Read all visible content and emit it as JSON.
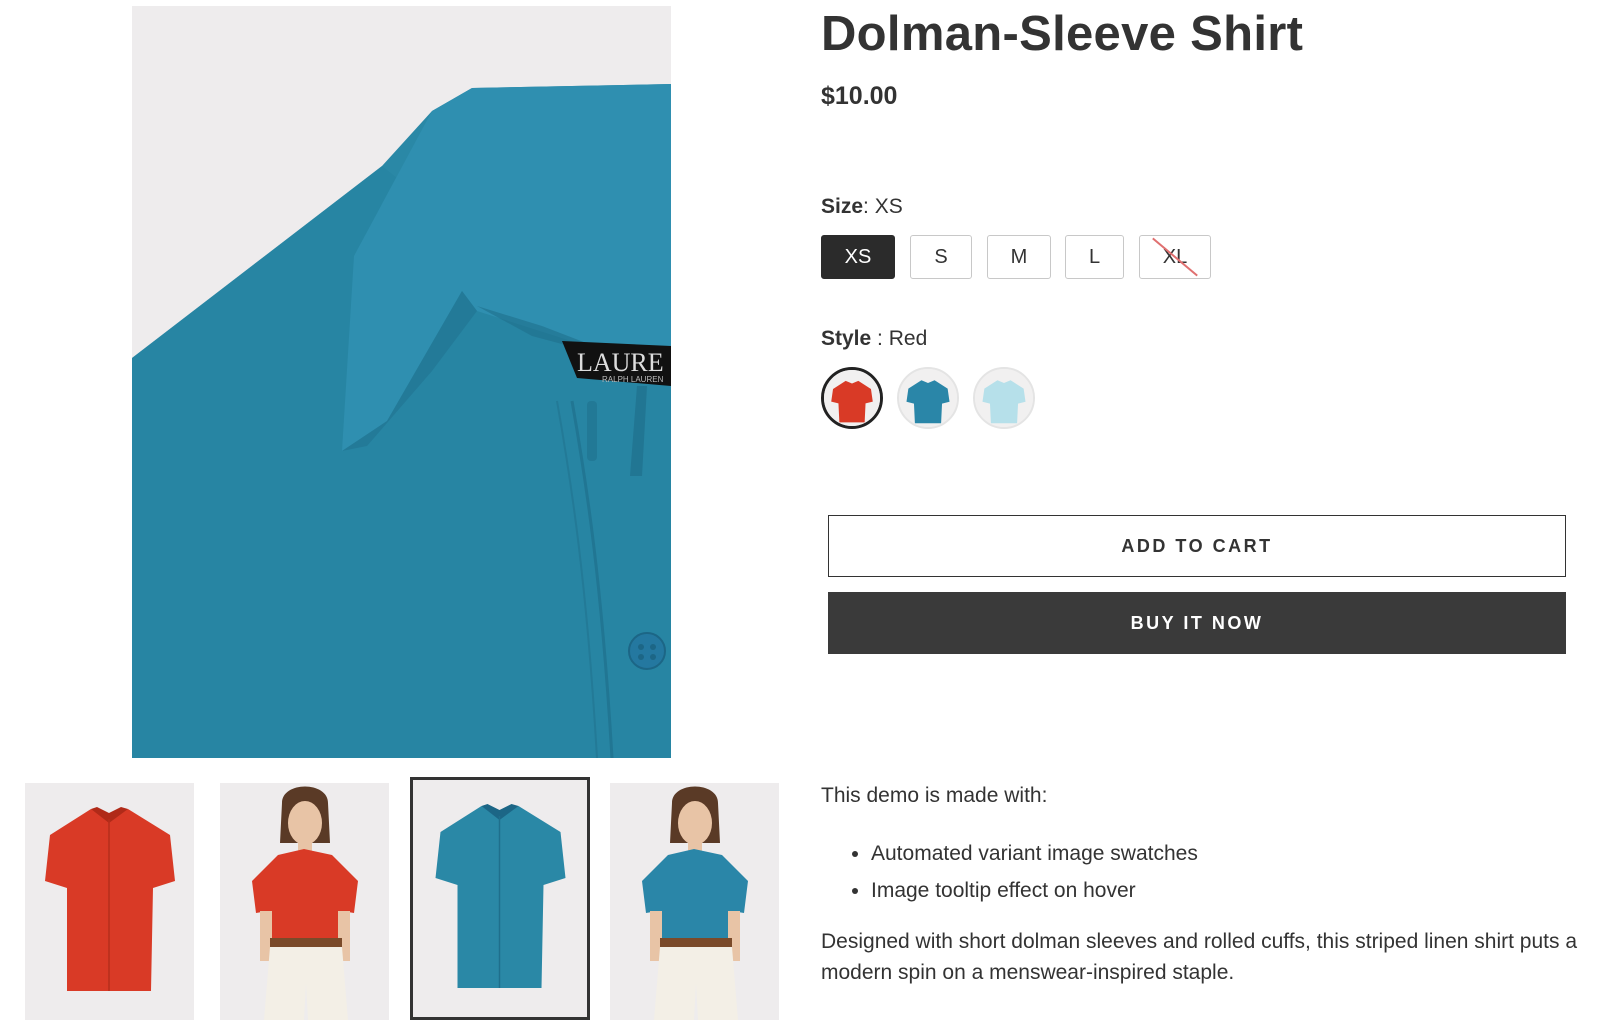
{
  "product": {
    "title": "Dolman-Sleeve Shirt",
    "price": "$10.00"
  },
  "size": {
    "label": "Size",
    "selected": "XS",
    "options": [
      {
        "value": "XS",
        "selected": true,
        "available": true
      },
      {
        "value": "S",
        "selected": false,
        "available": true
      },
      {
        "value": "M",
        "selected": false,
        "available": true
      },
      {
        "value": "L",
        "selected": false,
        "available": true
      },
      {
        "value": "XL",
        "selected": false,
        "available": false
      }
    ]
  },
  "style": {
    "label": "Style",
    "selected": "Red",
    "swatches": [
      {
        "color": "#d93a26",
        "selected": true
      },
      {
        "color": "#2a86a8",
        "selected": false
      },
      {
        "color": "#b6e0ea",
        "selected": false
      }
    ]
  },
  "buttons": {
    "add_to_cart": "ADD TO CART",
    "buy_now": "BUY IT NOW"
  },
  "gallery": {
    "main_color": "#2a88a6",
    "label_text": "LAURE",
    "label_subtext": "RALPH LAUREN",
    "thumbnails": [
      {
        "color": "#d93a26",
        "kind": "flat",
        "active": false
      },
      {
        "color": "#d93a26",
        "kind": "model",
        "active": false
      },
      {
        "color": "#2a88a6",
        "kind": "flat",
        "active": true
      },
      {
        "color": "#2a86a8",
        "kind": "model",
        "active": false
      }
    ]
  },
  "description": {
    "intro": "This demo is made with:",
    "features": [
      "Automated variant image swatches",
      "Image tooltip effect on hover"
    ],
    "body": "Designed with short dolman sleeves and rolled cuffs, this striped linen shirt puts a modern spin on a menswear-inspired staple."
  }
}
